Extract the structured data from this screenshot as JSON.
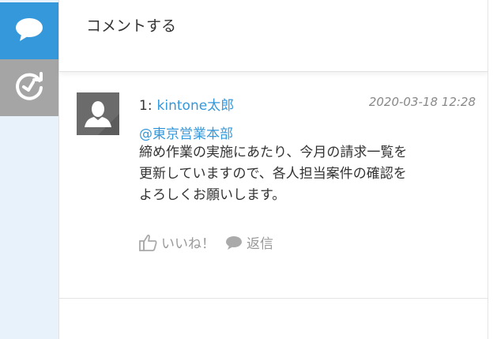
{
  "sidebar": {
    "tabs": [
      {
        "name": "comments",
        "icon": "speech-bubble-icon",
        "active": true,
        "color": "#3498db"
      },
      {
        "name": "history",
        "icon": "history-clock-icon",
        "active": false,
        "color": "#a5a5a5"
      }
    ]
  },
  "comment_input": {
    "placeholder": "コメントする"
  },
  "comment": {
    "number": "1:",
    "author": "kintone太郎",
    "date": "2020-03-18 12:28",
    "mention": "@東京営業本部",
    "body_lines": [
      "締め作業の実施にあたり、今月の請求一覧を",
      "更新していますので、各人担当案件の確認を",
      "よろしくお願いします。"
    ],
    "like_label": "いいね！",
    "reply_label": "返信"
  },
  "colors": {
    "accent": "#3498db",
    "muted": "#999999"
  }
}
